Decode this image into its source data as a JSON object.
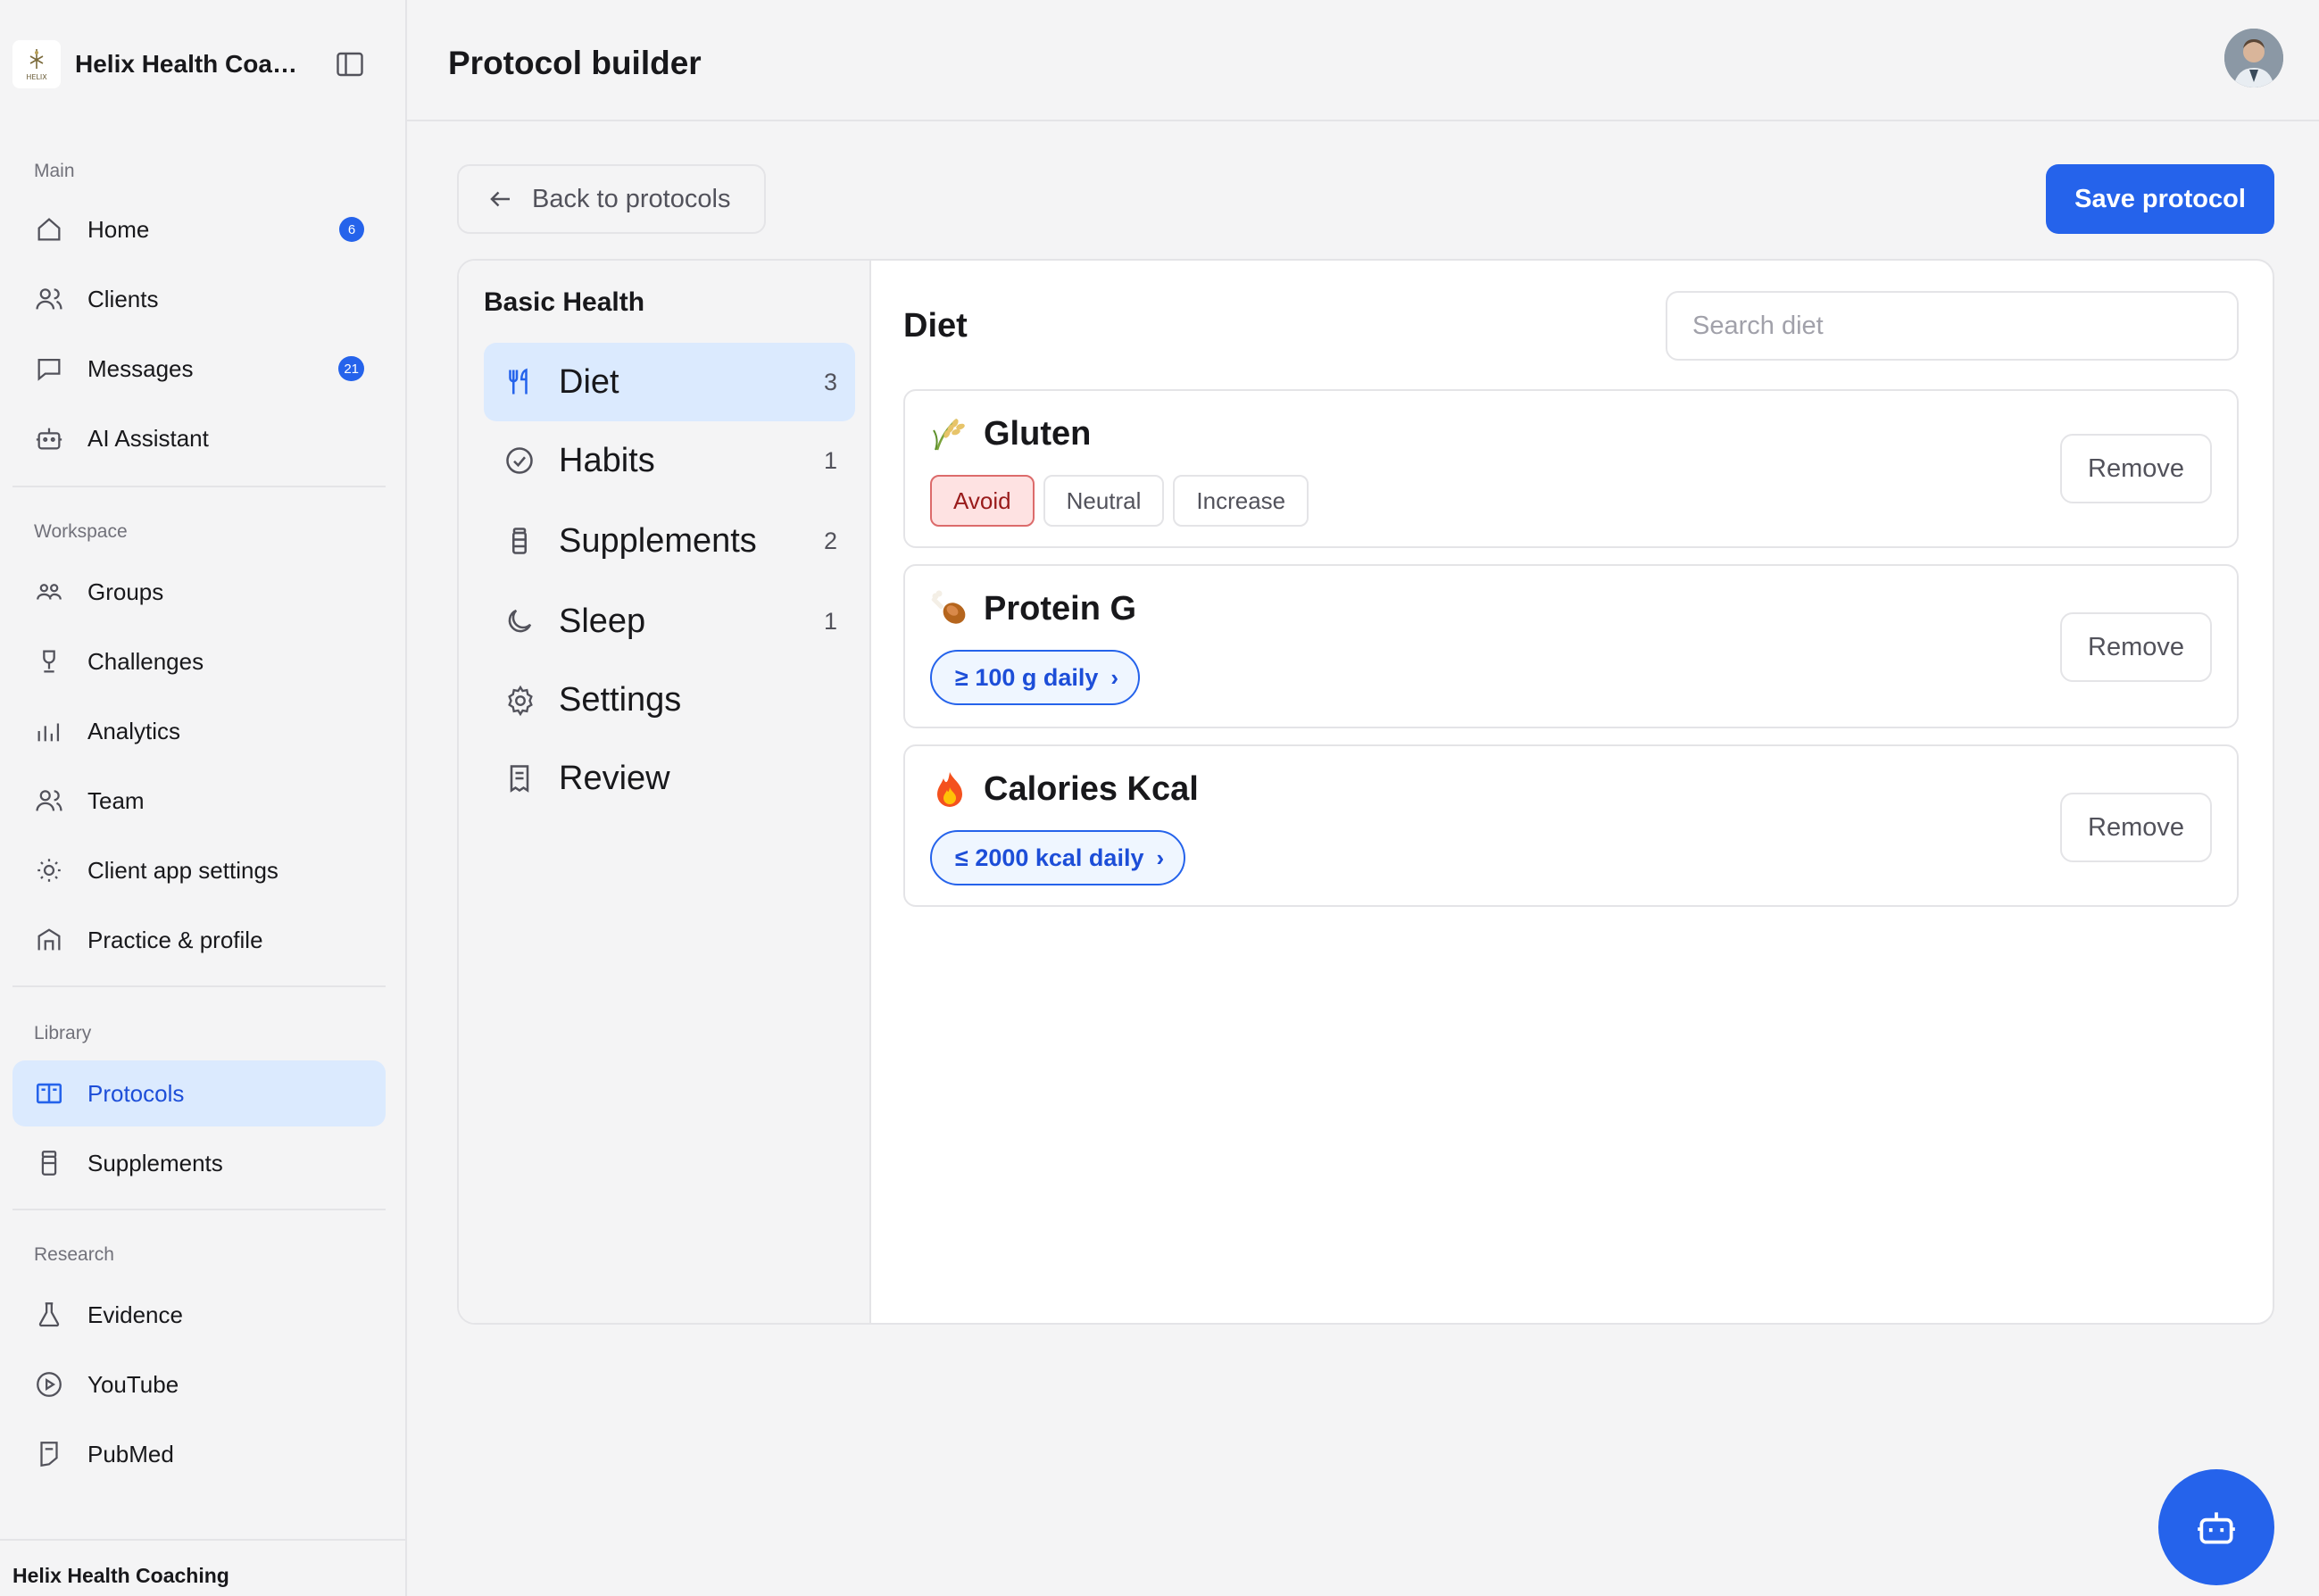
{
  "brand": {
    "name": "Helix Health Coaching",
    "logo_text": "HELIX"
  },
  "sidebar": {
    "sections": {
      "main": "Main",
      "workspace": "Workspace",
      "library": "Library",
      "research": "Research"
    },
    "main": [
      {
        "label": "Home",
        "badge": "6"
      },
      {
        "label": "Clients"
      },
      {
        "label": "Messages",
        "badge": "21"
      },
      {
        "label": "AI Assistant"
      }
    ],
    "workspace": [
      {
        "label": "Groups"
      },
      {
        "label": "Challenges"
      },
      {
        "label": "Analytics"
      },
      {
        "label": "Team"
      },
      {
        "label": "Client app settings"
      },
      {
        "label": "Practice & profile"
      }
    ],
    "library": [
      {
        "label": "Protocols",
        "active": true
      },
      {
        "label": "Supplements"
      }
    ],
    "research": [
      {
        "label": "Evidence"
      },
      {
        "label": "YouTube"
      },
      {
        "label": "PubMed"
      }
    ],
    "footer": "Helix Health Coaching"
  },
  "header": {
    "title": "Protocol builder"
  },
  "actions": {
    "back_label": "Back to protocols",
    "save_label": "Save protocol"
  },
  "builder": {
    "protocol_name": "Basic Health",
    "steps": [
      {
        "label": "Diet",
        "count": "3",
        "active": true
      },
      {
        "label": "Habits",
        "count": "1"
      },
      {
        "label": "Supplements",
        "count": "2"
      },
      {
        "label": "Sleep",
        "count": "1"
      },
      {
        "label": "Settings",
        "count": ""
      },
      {
        "label": "Review",
        "count": ""
      }
    ],
    "section_title": "Diet",
    "search_placeholder": "Search diet",
    "items": [
      {
        "name": "Gluten",
        "icon": "rice-emoji-icon",
        "options": [
          "Avoid",
          "Neutral",
          "Increase"
        ],
        "selected": "Avoid"
      },
      {
        "name": "Protein G",
        "icon": "poultry-leg-emoji-icon",
        "target": "≥ 100 g daily"
      },
      {
        "name": "Calories Kcal",
        "icon": "fire-emoji-icon",
        "target": "≤ 2000 kcal daily"
      }
    ],
    "remove_label": "Remove"
  },
  "colors": {
    "accent": "#2563eb",
    "accent_soft": "#dbeafe",
    "avoid_bg": "#fee2e2",
    "avoid_text": "#991b1b"
  }
}
